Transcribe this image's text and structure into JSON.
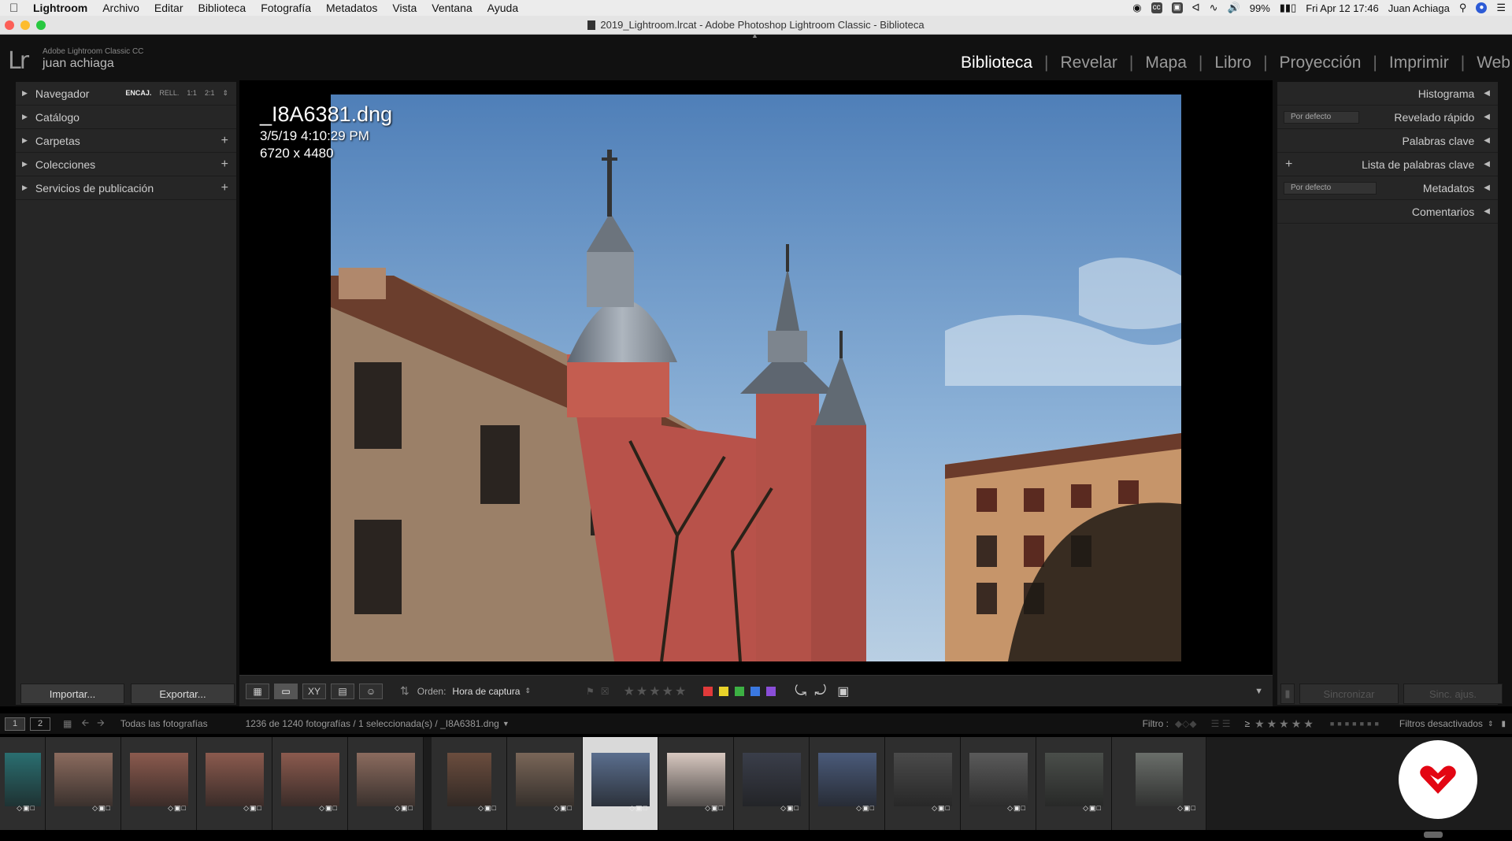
{
  "menubar": {
    "app": "Lightroom",
    "items": [
      "Archivo",
      "Editar",
      "Biblioteca",
      "Fotografía",
      "Metadatos",
      "Vista",
      "Ventana",
      "Ayuda"
    ],
    "battery": "99%",
    "datetime": "Fri Apr 12  17:46",
    "user": "Juan Achiaga"
  },
  "titlebar": {
    "title": "2019_Lightroom.lrcat - Adobe Photoshop Lightroom Classic - Biblioteca"
  },
  "identity": {
    "logo": "Lr",
    "product": "Adobe Lightroom Classic CC",
    "user": "juan achiaga"
  },
  "modules": [
    {
      "label": "Biblioteca",
      "active": true
    },
    {
      "label": "Revelar"
    },
    {
      "label": "Mapa"
    },
    {
      "label": "Libro"
    },
    {
      "label": "Proyección"
    },
    {
      "label": "Imprimir"
    },
    {
      "label": "Web"
    }
  ],
  "left_panel": {
    "navigator": {
      "label": "Navegador",
      "options": [
        "ENCAJ.",
        "RELL.",
        "1:1",
        "2:1"
      ]
    },
    "sections": [
      {
        "label": "Catálogo",
        "plus": ""
      },
      {
        "label": "Carpetas",
        "plus": "+"
      },
      {
        "label": "Colecciones",
        "plus": "+"
      },
      {
        "label": "Servicios de publicación",
        "plus": "+"
      }
    ],
    "import_label": "Importar...",
    "export_label": "Exportar..."
  },
  "right_panel": {
    "sections": [
      {
        "label": "Histograma"
      },
      {
        "label": "Revelado rápido",
        "select": "Por defecto"
      },
      {
        "label": "Palabras clave"
      },
      {
        "label": "Lista de palabras clave",
        "plus": "+"
      },
      {
        "label": "Metadatos",
        "select": "Por defecto"
      },
      {
        "label": "Comentarios"
      }
    ],
    "sync_label": "Sincronizar",
    "sync_settings_label": "Sinc. ajus."
  },
  "photo_info": {
    "filename": "_I8A6381.dng",
    "date": "3/5/19 4:10:29 PM",
    "dimensions": "6720 x 4480"
  },
  "toolbar": {
    "sort_label": "Orden:",
    "sort_value": "Hora de captura",
    "stars": "★★★★★",
    "colors": [
      "#e03a3a",
      "#e8d22a",
      "#3cb043",
      "#3a78e0",
      "#8a4ed8"
    ]
  },
  "filmstrip_header": {
    "monitor1": "1",
    "monitor2": "2",
    "source": "Todas las fotografías",
    "count": "1236 de 1240 fotografías / 1 seleccionada(s) / _I8A6381.dng",
    "filter_label": "Filtro :",
    "filter_op": "≥",
    "filter_stars": "★★★★★",
    "filter_status": "Filtros desactivados"
  },
  "filmstrip": {
    "thumbs": [
      {
        "tone": "#2a6e70",
        "badges": ""
      },
      {
        "tone": "#8b6b5e",
        "badges": ""
      },
      {
        "tone": "#8b5a4e",
        "badges": ""
      },
      {
        "tone": "#8b5a4e",
        "badges": ""
      },
      {
        "tone": "#8b5a4e",
        "badges": ""
      },
      {
        "tone": "#8b6b5e",
        "badges": ""
      },
      {
        "tone": "#6b4d3e",
        "badges": ""
      },
      {
        "tone": "#7a6658",
        "badges": ""
      },
      {
        "tone": "#5a6e8e",
        "badges": "",
        "selected": true
      },
      {
        "tone": "#d8c8c0",
        "badges": ""
      },
      {
        "tone": "#3a3e4a",
        "badges": ""
      },
      {
        "tone": "#4a5a7a",
        "badges": ""
      },
      {
        "tone": "#4a4a4a",
        "badges": ""
      },
      {
        "tone": "#5a5a5a",
        "badges": ""
      },
      {
        "tone": "#4a4e4a",
        "badges": ""
      },
      {
        "tone": "#6a6e6a",
        "badges": ""
      }
    ]
  },
  "colors": {
    "accent": "#e30613",
    "panel": "#262626",
    "background": "#000000"
  }
}
